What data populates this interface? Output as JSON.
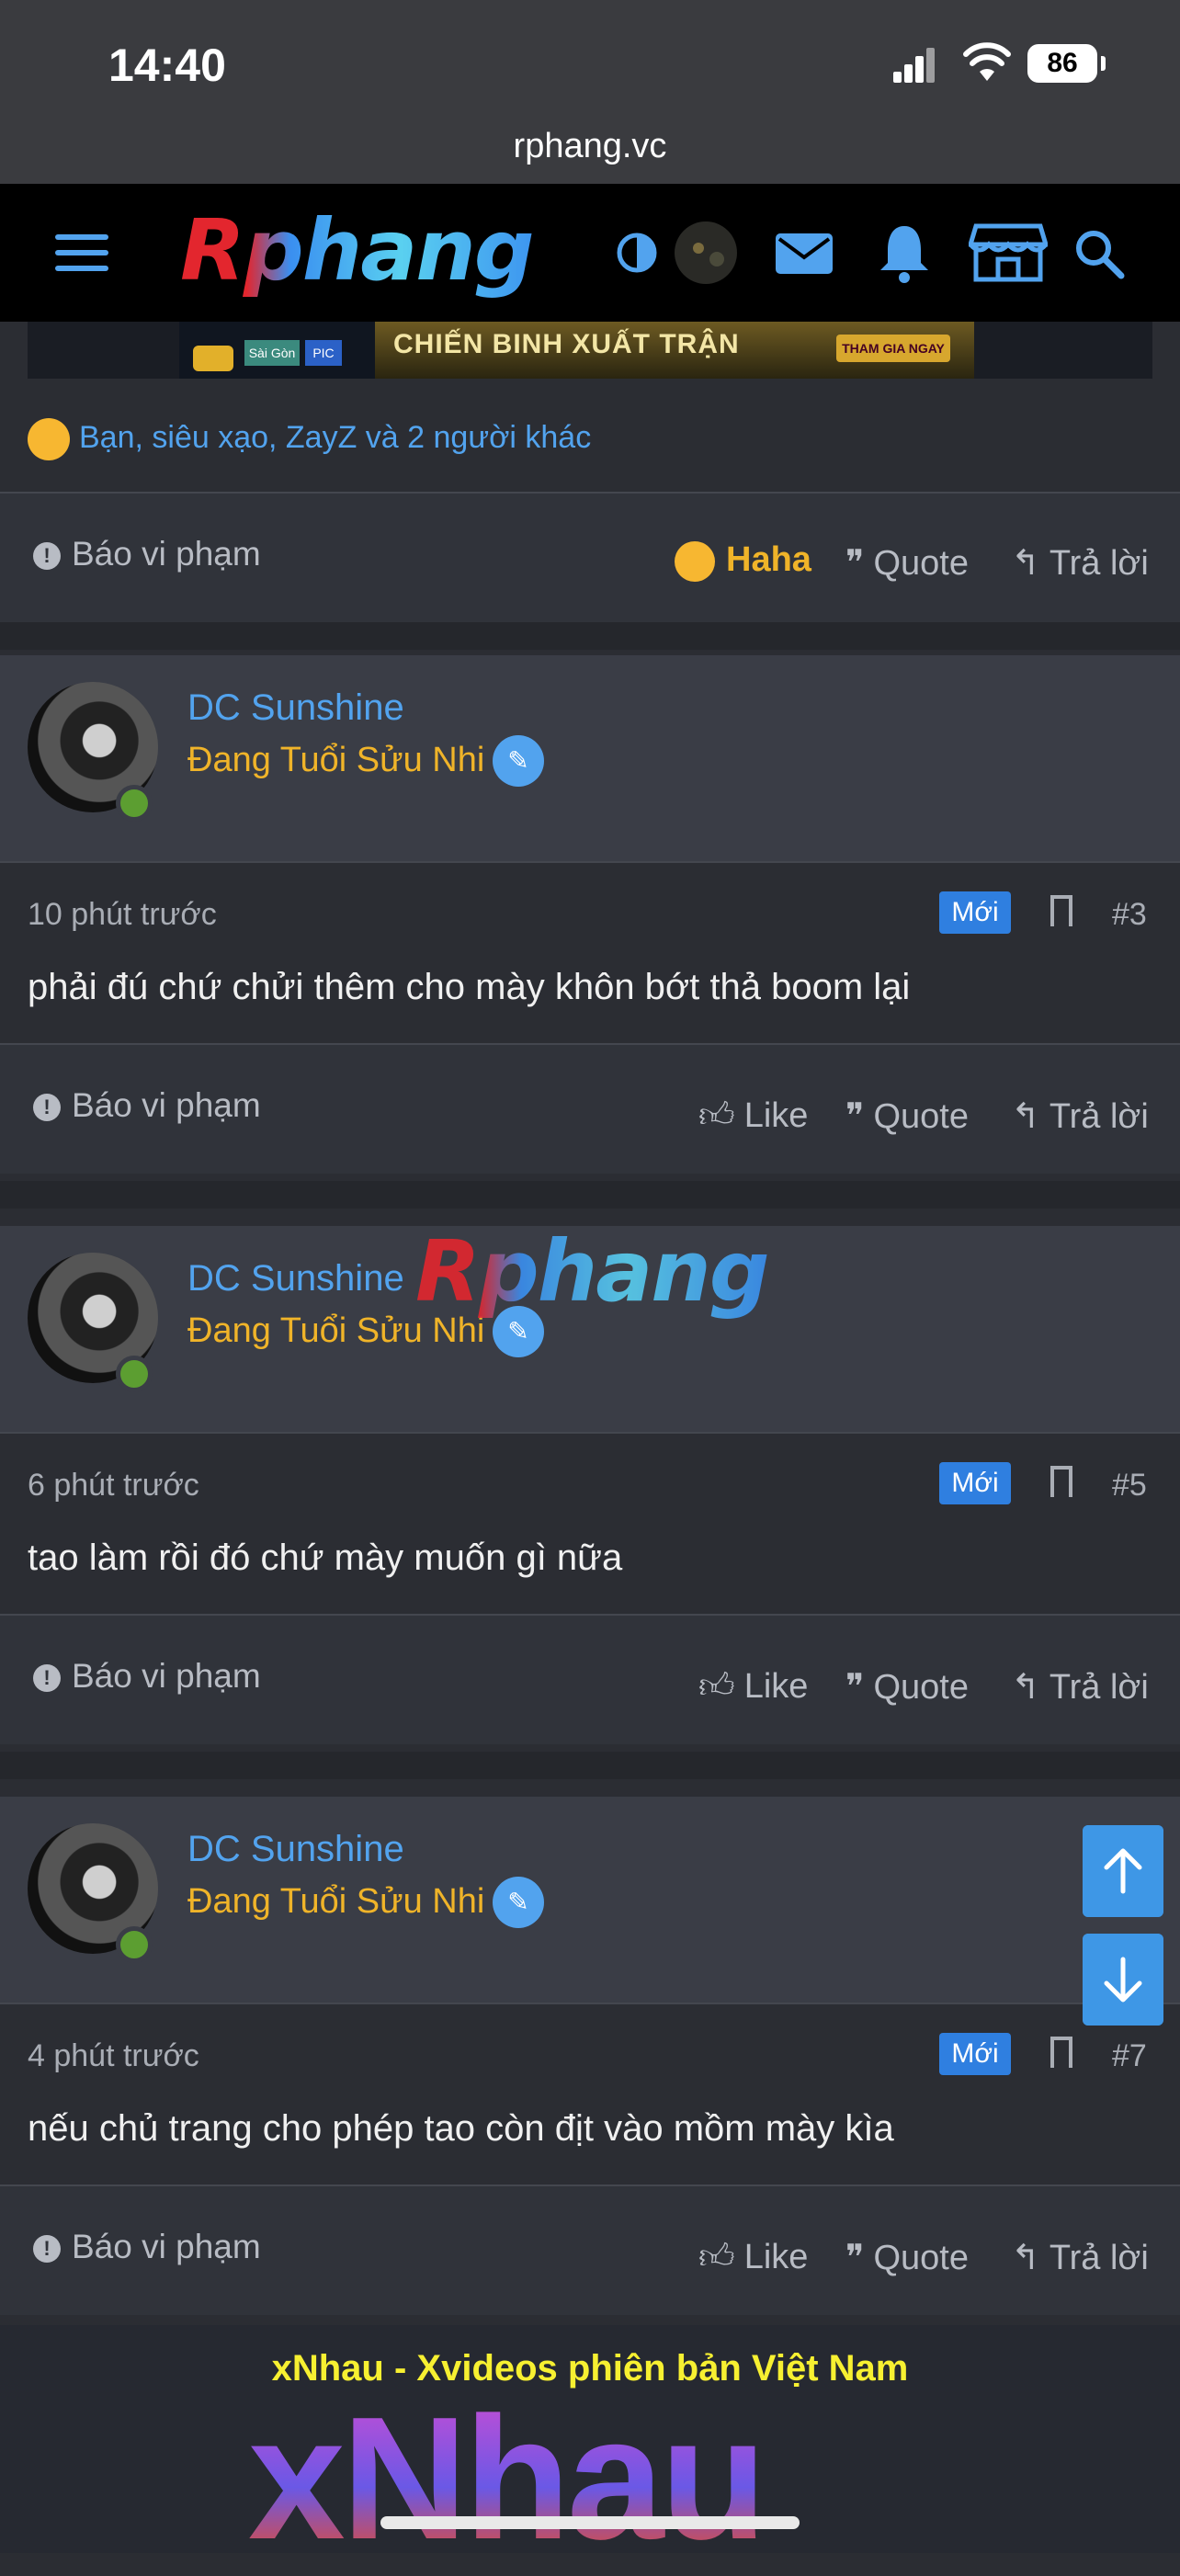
{
  "status": {
    "time": "14:40",
    "battery": "86"
  },
  "browser": {
    "url": "rphang.vc"
  },
  "header": {
    "logo": "Rphang"
  },
  "reactions": {
    "summary": "Bạn, siêu xạo, ZayZ và 2 người khác"
  },
  "action_labels": {
    "report": "Báo vi phạm",
    "haha": "Haha",
    "like": "Like",
    "quote": "Quote",
    "reply": "Trả lời"
  },
  "banner": {
    "text": "CHIẾN BINH XUẤT TRẬN",
    "cta": "THAM GIA NGAY",
    "sg": "Sài Gòn",
    "pic": "PIC"
  },
  "posts": [
    {
      "author": "DC Sunshine",
      "title": "Đang Tuổi Sửu Nhi",
      "time_ago": "10 phút trước",
      "badge": "Mới",
      "number": "#3",
      "text": "phải đú chứ chửi thêm cho mày khôn bớt thả boom lại"
    },
    {
      "author": "DC Sunshine",
      "title": "Đang Tuổi Sửu Nhi",
      "time_ago": "6 phút trước",
      "badge": "Mới",
      "number": "#5",
      "text": "tao làm rồi đó chứ mày muốn gì nữa"
    },
    {
      "author": "DC Sunshine",
      "title": "Đang Tuổi Sửu Nhi",
      "time_ago": "4 phút trước",
      "badge": "Mới",
      "number": "#7",
      "text": "nếu chủ trang cho phép tao còn địt vào mồm mày kìa"
    }
  ],
  "watermark": "Rphang",
  "footer_ad": {
    "title": "xNhau - Xvideos phiên bản Việt Nam",
    "logo": "xNhau"
  },
  "colors": {
    "link": "#52a3ee",
    "gold": "#f0b429",
    "new_badge": "#2f7fe0",
    "online": "#5c9e31"
  }
}
